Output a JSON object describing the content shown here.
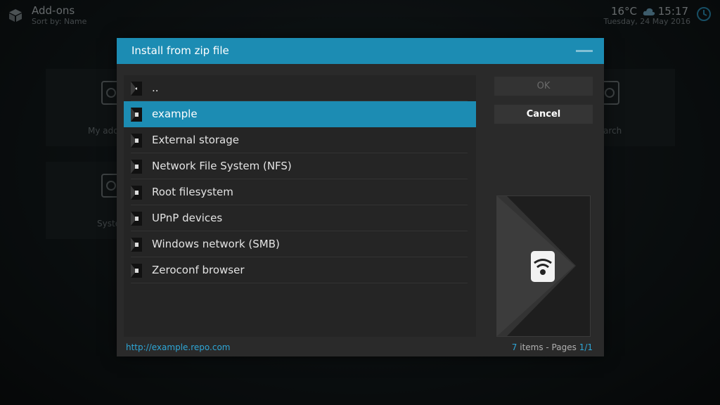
{
  "header": {
    "title": "Add-ons",
    "subtitle": "Sort by: Name",
    "temperature": "16°C",
    "time": "15:17",
    "date": "Tuesday, 24 May 2016"
  },
  "background_tiles": [
    {
      "label": "My add"
    },
    {
      "label": "arch"
    },
    {
      "label": "Syste"
    }
  ],
  "dialog": {
    "title": "Install from zip file",
    "items": [
      {
        "label": ".."
      },
      {
        "label": "example"
      },
      {
        "label": "External storage"
      },
      {
        "label": "Network File System (NFS)"
      },
      {
        "label": "Root filesystem"
      },
      {
        "label": "UPnP devices"
      },
      {
        "label": "Windows network (SMB)"
      },
      {
        "label": "Zeroconf browser"
      }
    ],
    "selected_index": 1,
    "ok_label": "OK",
    "cancel_label": "Cancel",
    "path": "http://example.repo.com",
    "count": "7",
    "count_text": " items - Pages ",
    "pages": "1/1"
  },
  "colors": {
    "accent": "#1c8cb3",
    "dialog_bg": "#2a2a2a"
  }
}
